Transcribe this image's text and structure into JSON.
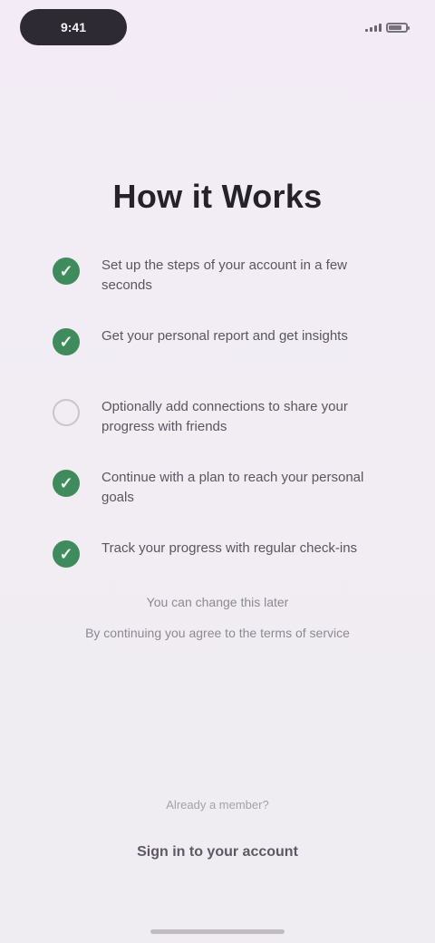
{
  "status_bar": {
    "pill_label": "9:41",
    "right_text": ""
  },
  "title": "How it Works",
  "steps": [
    {
      "state": "done",
      "text": "Set up the steps of your account in a few seconds"
    },
    {
      "state": "done",
      "text": "Get your personal report and get insights"
    },
    {
      "state": "pending",
      "text": "Optionally add connections to share your progress with friends"
    },
    {
      "state": "done",
      "text": "Continue with a plan to reach your personal goals"
    },
    {
      "state": "done",
      "text": "Track your progress with regular check-ins"
    }
  ],
  "footer_note": {
    "line1": "You can change this later",
    "line2": "By continuing you agree to the terms of service"
  },
  "bottom": {
    "small_text": "Already a member?",
    "link_text": "Sign in to your account"
  },
  "colors": {
    "accent_green": "#3f8b5d"
  }
}
